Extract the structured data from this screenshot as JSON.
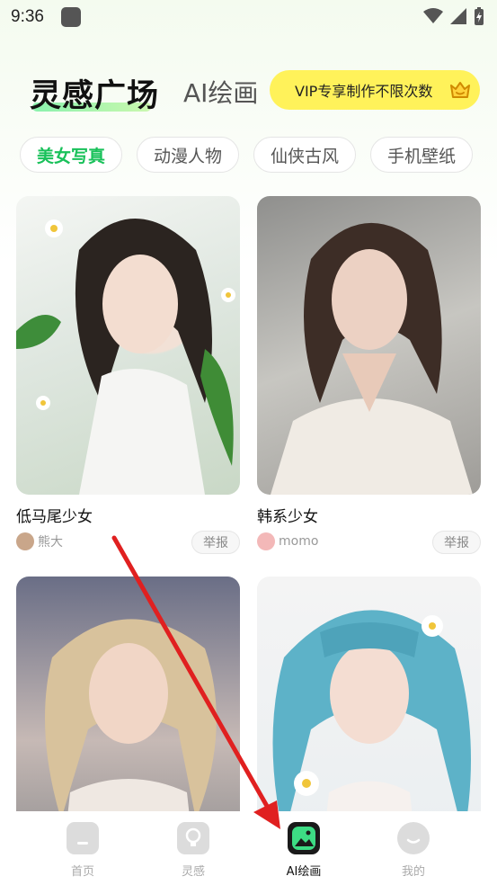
{
  "status_bar": {
    "time": "9:36"
  },
  "header": {
    "title": "灵感广场",
    "subtitle": "AI绘画",
    "vip_text": "VIP专享制作不限次数"
  },
  "tabs": [
    {
      "label": "美女写真",
      "active": true
    },
    {
      "label": "动漫人物",
      "active": false
    },
    {
      "label": "仙侠古风",
      "active": false
    },
    {
      "label": "手机壁纸",
      "active": false
    }
  ],
  "cards": [
    {
      "title": "低马尾少女",
      "author": "熊大",
      "report": "举报"
    },
    {
      "title": "韩系少女",
      "author": "momo",
      "report": "举报"
    },
    {
      "title": "",
      "author": "",
      "report": ""
    },
    {
      "title": "",
      "author": "",
      "report": ""
    }
  ],
  "bottom_nav": [
    {
      "label": "首页",
      "icon": "home-icon",
      "active": false
    },
    {
      "label": "灵感",
      "icon": "bulb-icon",
      "active": false
    },
    {
      "label": "AI绘画",
      "icon": "picture-icon",
      "active": true
    },
    {
      "label": "我的",
      "icon": "profile-icon",
      "active": false
    }
  ],
  "colors": {
    "accent": "#19c15a",
    "vip": "#fff25a",
    "annotation_arrow": "#e02020"
  }
}
